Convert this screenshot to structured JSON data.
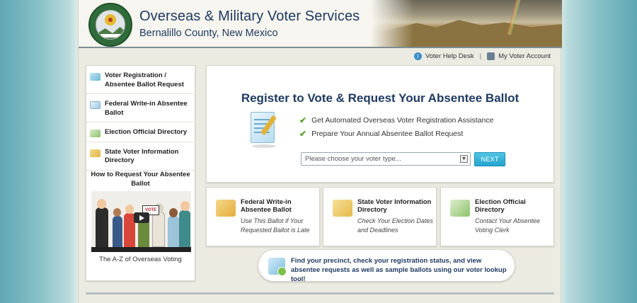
{
  "header": {
    "title": "Overseas & Military Voter Services",
    "subtitle": "Bernalillo County, New Mexico"
  },
  "util_nav": {
    "help_desk": "Voter Help Desk",
    "separator": "|",
    "account": "My Voter Account"
  },
  "sidebar": {
    "items": [
      {
        "label": "Voter Registration / Absentee Ballot Request",
        "icon": "registration-icon"
      },
      {
        "label": "Federal Write-in Absentee Ballot",
        "icon": "ballot-icon"
      },
      {
        "label": "Election Official Directory",
        "icon": "directory-icon"
      },
      {
        "label": "State Voter Information Directory",
        "icon": "folder-icon"
      }
    ],
    "howto_title": "How to Request Your Absentee Ballot",
    "video_sign": "VOTE",
    "video_caption": "The A-Z of Overseas Voting"
  },
  "register": {
    "heading": "Register to Vote & Request Your Absentee Ballot",
    "bullets": [
      "Get Automated Overseas Voter Registration Assistance",
      "Prepare Your Annual Absentee Ballot Request"
    ],
    "select_placeholder": "Please choose your voter type...",
    "next_label": "NEXT"
  },
  "cards": [
    {
      "title": "Federal Write-in Absentee Ballot",
      "desc": "Use This Ballot if Your Requested Ballot is Late"
    },
    {
      "title": "State Voter Information Directory",
      "desc": "Check Your Election Dates and Deadlines"
    },
    {
      "title": "Election Official Directory",
      "desc": "Contact Your Absentee Voting Clerk"
    }
  ],
  "lookup": {
    "text": "Find your precinct, check your registration status, and view absentee requests as well as sample ballots using our voter lookup tool!"
  },
  "colors": {
    "heading": "#1f3a60",
    "accent": "#24a3cf",
    "check": "#5aa02c"
  }
}
